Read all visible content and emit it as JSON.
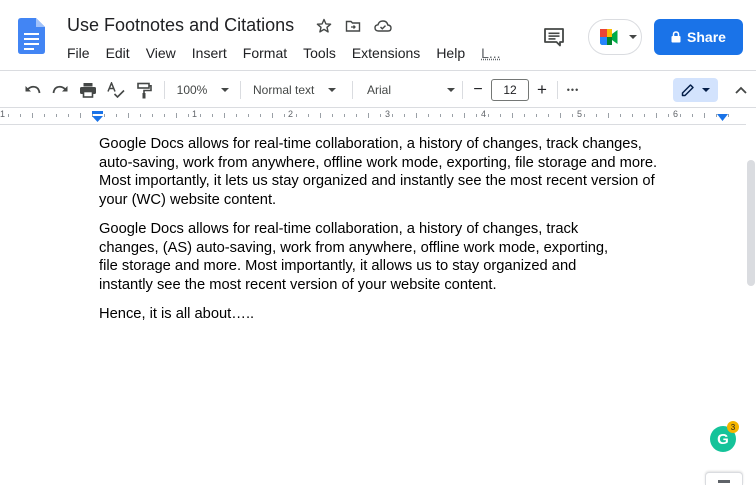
{
  "doc": {
    "title": "Use Footnotes and Citations"
  },
  "menu": {
    "items": [
      "File",
      "Edit",
      "View",
      "Insert",
      "Format",
      "Tools",
      "Extensions",
      "Help",
      "L..."
    ]
  },
  "header": {
    "share_label": "Share"
  },
  "toolbar": {
    "zoom": "100%",
    "style": "Normal text",
    "font": "Arial",
    "font_size": "12",
    "minus": "−",
    "plus": "+",
    "more": "•••"
  },
  "ruler": {
    "numbers": [
      "1",
      "1",
      "2",
      "3",
      "4",
      "5",
      "6"
    ]
  },
  "content": {
    "paragraphs": [
      {
        "lines": [
          "Google Docs allows for real-time collaboration, a history of changes, track changes,",
          "auto-saving, work from anywhere, offline work mode, exporting, file storage and more.",
          "Most importantly, it lets us stay organized and instantly see the most recent version of",
          "your (WC) website content."
        ]
      },
      {
        "lines": [
          "Google Docs allows for real-time collaboration, a history of changes, track",
          "changes, (AS) auto-saving, work from anywhere, offline work mode, exporting,",
          "file storage and more. Most importantly, it allows us to stay organized and",
          "instantly see the most recent version of your website content."
        ]
      },
      {
        "lines": [
          "Hence, it is all about….."
        ]
      }
    ]
  },
  "grammarly": {
    "letter": "G",
    "count": "3"
  },
  "colors": {
    "accent": "#1a73e8",
    "docs_blue": "#4285f4",
    "grammarly_green": "#15c39a"
  },
  "icons": [
    "docs-logo-icon",
    "star-icon",
    "move-folder-icon",
    "cloud-saved-icon",
    "comments-icon",
    "meet-icon",
    "lock-icon",
    "undo-icon",
    "redo-icon",
    "print-icon",
    "spellcheck-icon",
    "paint-format-icon",
    "edit-pencil-icon",
    "collapse-chevron-icon"
  ]
}
